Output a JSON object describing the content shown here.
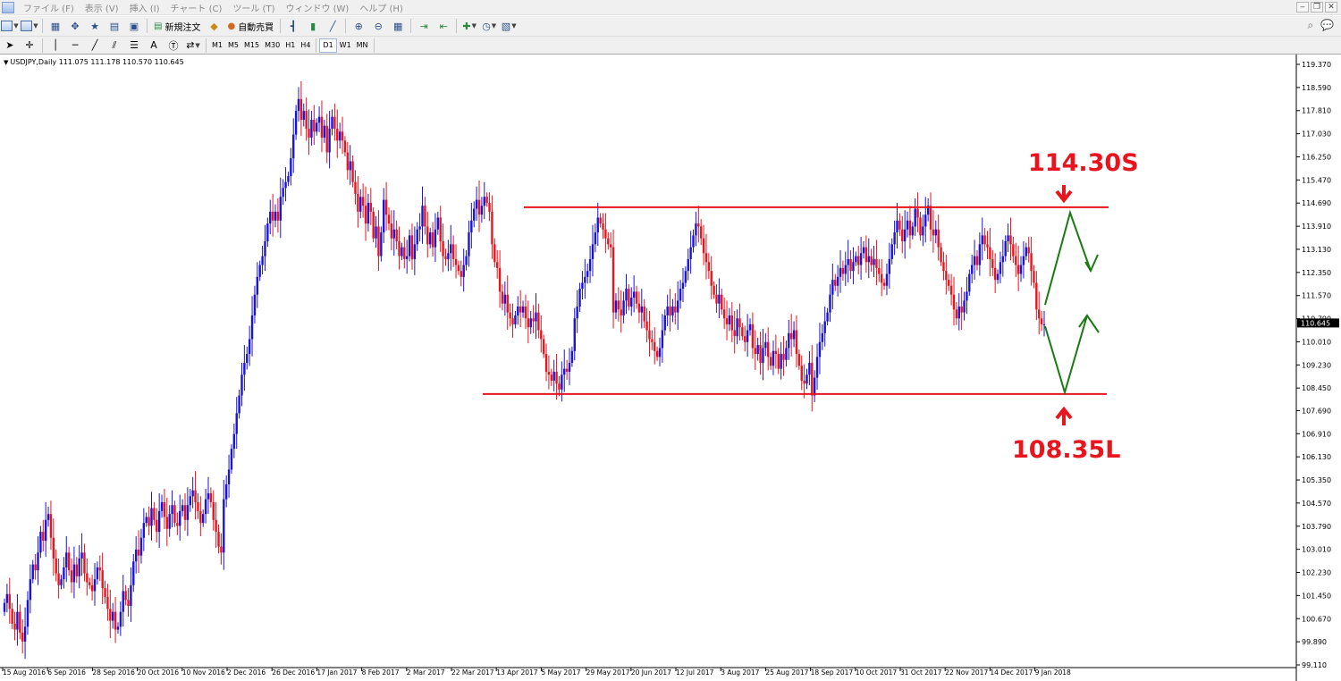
{
  "menu": {
    "items": [
      "ファイル (F)",
      "表示 (V)",
      "挿入 (I)",
      "チャート (C)",
      "ツール (T)",
      "ウィンドウ (W)",
      "ヘルプ (H)"
    ]
  },
  "toolbar": {
    "new_order_label": "新規注文",
    "auto_trading_label": "自動売買",
    "timeframes": [
      "M1",
      "M5",
      "M15",
      "M30",
      "H1",
      "H4",
      "D1",
      "W1",
      "MN"
    ],
    "active_timeframe": "D1"
  },
  "chart": {
    "title": "USDJPY,Daily  111.075 111.178 110.570 110.645",
    "current_price": "110.645"
  },
  "annotations": {
    "sell_label": "114.30S",
    "buy_label": "108.35L"
  },
  "colors": {
    "bull_candle": "#1a14d6",
    "bear_candle": "#e8141e",
    "range_line": "#e8141e",
    "projection_arrow": "#1a7a12",
    "price_tag_bg": "#000000"
  },
  "chart_data": {
    "type": "candlestick",
    "symbol": "USDJPY",
    "timeframe": "Daily",
    "y_ticks": [
      "119.370",
      "118.590",
      "117.810",
      "117.030",
      "116.250",
      "115.470",
      "114.690",
      "113.910",
      "113.130",
      "112.350",
      "111.570",
      "110.790",
      "110.010",
      "109.230",
      "108.450",
      "107.690",
      "106.910",
      "106.130",
      "105.350",
      "104.570",
      "103.790",
      "103.010",
      "102.230",
      "101.450",
      "100.670",
      "99.890",
      "99.110"
    ],
    "ylim": [
      99.11,
      119.37
    ],
    "x_ticks": [
      "15 Aug 2016",
      "6 Sep 2016",
      "28 Sep 2016",
      "20 Oct 2016",
      "10 Nov 2016",
      "2 Dec 2016",
      "26 Dec 2016",
      "17 Jan 2017",
      "8 Feb 2017",
      "2 Mar 2017",
      "22 Mar 2017",
      "13 Apr 2017",
      "5 May 2017",
      "29 May 2017",
      "20 Jun 2017",
      "12 Jul 2017",
      "3 Aug 2017",
      "25 Aug 2017",
      "18 Sep 2017",
      "10 Oct 2017",
      "31 Oct 2017",
      "22 Nov 2017",
      "14 Dec 2017",
      "9 Jan 2018"
    ],
    "closes": [
      101.2,
      101.5,
      101.0,
      100.5,
      100.3,
      100.9,
      100.2,
      99.9,
      100.4,
      101.3,
      102.0,
      102.5,
      102.3,
      102.9,
      103.6,
      103.3,
      104.0,
      104.2,
      103.4,
      102.7,
      102.2,
      101.8,
      102.0,
      102.4,
      102.9,
      102.3,
      101.9,
      102.5,
      102.1,
      102.7,
      102.9,
      102.2,
      101.9,
      101.8,
      101.6,
      102.0,
      102.4,
      102.3,
      101.7,
      101.4,
      101.0,
      100.6,
      100.9,
      100.3,
      100.4,
      100.9,
      101.6,
      101.3,
      101.1,
      101.8,
      102.6,
      103.0,
      102.8,
      103.4,
      103.9,
      104.1,
      103.8,
      104.4,
      104.0,
      103.6,
      104.3,
      104.6,
      104.1,
      103.7,
      104.2,
      104.5,
      103.9,
      103.8,
      104.3,
      104.5,
      104.0,
      104.5,
      104.8,
      105.0,
      104.6,
      104.3,
      103.9,
      104.2,
      104.7,
      104.9,
      104.6,
      104.0,
      103.6,
      103.1,
      102.9,
      104.7,
      105.2,
      105.7,
      106.4,
      106.9,
      107.6,
      108.2,
      108.9,
      109.3,
      109.6,
      110.1,
      110.9,
      111.6,
      112.2,
      112.6,
      112.9,
      113.4,
      114.0,
      114.4,
      114.1,
      114.4,
      114.1,
      114.9,
      115.2,
      115.4,
      115.6,
      116.2,
      117.0,
      117.8,
      118.2,
      117.5,
      117.8,
      117.2,
      116.9,
      117.5,
      117.1,
      117.4,
      117.6,
      116.9,
      117.3,
      116.4,
      117.2,
      117.6,
      117.2,
      116.8,
      117.1,
      116.8,
      116.4,
      115.8,
      116.1,
      115.4,
      115.0,
      114.4,
      114.9,
      114.6,
      114.0,
      114.7,
      114.4,
      113.5,
      113.9,
      112.9,
      113.7,
      114.8,
      114.3,
      114.0,
      113.5,
      113.8,
      113.4,
      112.9,
      113.2,
      112.8,
      112.9,
      113.6,
      112.8,
      113.3,
      113.8,
      113.9,
      114.6,
      113.9,
      113.3,
      113.7,
      113.2,
      113.8,
      114.2,
      113.4,
      112.9,
      112.8,
      113.0,
      113.3,
      112.8,
      112.6,
      112.4,
      112.2,
      112.6,
      112.9,
      113.7,
      114.1,
      114.5,
      114.8,
      114.3,
      114.6,
      114.9,
      114.7,
      114.4,
      113.3,
      112.7,
      112.5,
      111.7,
      111.3,
      111.6,
      111.0,
      110.8,
      110.6,
      110.9,
      111.2,
      111.0,
      111.2,
      110.8,
      110.5,
      110.8,
      110.7,
      111.0,
      110.4,
      110.1,
      109.6,
      109.0,
      108.9,
      108.7,
      109.0,
      108.6,
      108.4,
      108.9,
      109.1,
      109.0,
      109.3,
      109.7,
      110.8,
      111.2,
      111.8,
      112.0,
      112.2,
      112.4,
      112.8,
      113.3,
      113.7,
      114.2,
      114.0,
      113.8,
      113.5,
      113.3,
      113.2,
      111.0,
      111.4,
      111.1,
      110.9,
      111.4,
      111.8,
      111.2,
      111.5,
      111.7,
      111.3,
      111.0,
      111.2,
      110.7,
      110.4,
      110.1,
      110.0,
      109.7,
      109.5,
      109.8,
      110.4,
      110.9,
      111.2,
      110.9,
      111.2,
      111.0,
      111.4,
      111.8,
      112.0,
      112.4,
      112.8,
      113.2,
      113.6,
      114.0,
      113.9,
      113.5,
      113.0,
      112.7,
      112.4,
      111.9,
      111.6,
      111.3,
      111.6,
      111.1,
      110.8,
      110.6,
      110.9,
      110.4,
      110.2,
      110.8,
      110.5,
      110.2,
      110.0,
      110.4,
      110.6,
      109.8,
      109.6,
      109.9,
      109.3,
      109.8,
      110.0,
      109.5,
      109.2,
      109.7,
      109.6,
      109.1,
      109.6,
      109.4,
      109.8,
      110.3,
      110.1,
      110.4,
      109.6,
      109.2,
      108.7,
      108.6,
      108.9,
      109.3,
      108.2,
      108.8,
      109.5,
      110.0,
      110.3,
      110.7,
      111.0,
      111.6,
      112.1,
      111.9,
      112.2,
      112.5,
      112.3,
      112.6,
      112.8,
      112.4,
      112.7,
      112.9,
      112.6,
      113.0,
      113.2,
      112.7,
      112.9,
      112.6,
      112.8,
      112.5,
      112.3,
      112.0,
      111.9,
      112.3,
      112.8,
      113.3,
      113.7,
      114.1,
      113.8,
      113.4,
      113.8,
      114.1,
      113.6,
      113.9,
      114.5,
      114.2,
      113.6,
      113.9,
      114.3,
      114.6,
      113.8,
      113.6,
      113.8,
      113.2,
      112.7,
      112.4,
      112.1,
      111.9,
      111.6,
      111.1,
      110.8,
      111.2,
      111.0,
      111.4,
      111.7,
      112.3,
      112.6,
      112.9,
      112.6,
      113.3,
      113.6,
      113.3,
      113.2,
      112.8,
      112.5,
      112.1,
      112.3,
      112.7,
      112.9,
      113.4,
      113.6,
      113.3,
      112.9,
      112.6,
      112.3,
      112.6,
      112.9,
      113.2,
      113.0,
      112.4,
      112.0,
      111.1,
      110.8,
      110.6,
      110.6
    ],
    "range_levels": [
      114.55,
      108.25
    ],
    "labels": {
      "sell": "114.30S",
      "buy": "108.35L"
    }
  }
}
